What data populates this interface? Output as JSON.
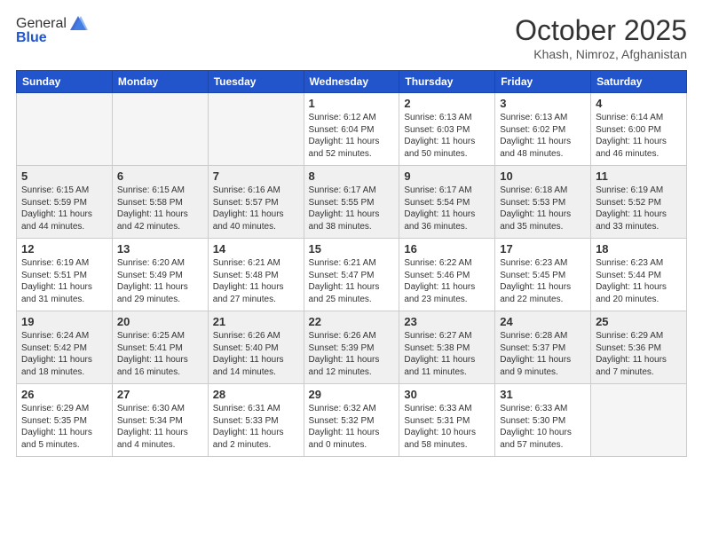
{
  "header": {
    "logo_general": "General",
    "logo_blue": "Blue",
    "month_title": "October 2025",
    "subtitle": "Khash, Nimroz, Afghanistan"
  },
  "weekdays": [
    "Sunday",
    "Monday",
    "Tuesday",
    "Wednesday",
    "Thursday",
    "Friday",
    "Saturday"
  ],
  "weeks": [
    [
      {
        "day": "",
        "empty": true
      },
      {
        "day": "",
        "empty": true
      },
      {
        "day": "",
        "empty": true
      },
      {
        "day": "1",
        "sunrise": "6:12 AM",
        "sunset": "6:04 PM",
        "daylight": "11 hours and 52 minutes."
      },
      {
        "day": "2",
        "sunrise": "6:13 AM",
        "sunset": "6:03 PM",
        "daylight": "11 hours and 50 minutes."
      },
      {
        "day": "3",
        "sunrise": "6:13 AM",
        "sunset": "6:02 PM",
        "daylight": "11 hours and 48 minutes."
      },
      {
        "day": "4",
        "sunrise": "6:14 AM",
        "sunset": "6:00 PM",
        "daylight": "11 hours and 46 minutes."
      }
    ],
    [
      {
        "day": "5",
        "sunrise": "6:15 AM",
        "sunset": "5:59 PM",
        "daylight": "11 hours and 44 minutes."
      },
      {
        "day": "6",
        "sunrise": "6:15 AM",
        "sunset": "5:58 PM",
        "daylight": "11 hours and 42 minutes."
      },
      {
        "day": "7",
        "sunrise": "6:16 AM",
        "sunset": "5:57 PM",
        "daylight": "11 hours and 40 minutes."
      },
      {
        "day": "8",
        "sunrise": "6:17 AM",
        "sunset": "5:55 PM",
        "daylight": "11 hours and 38 minutes."
      },
      {
        "day": "9",
        "sunrise": "6:17 AM",
        "sunset": "5:54 PM",
        "daylight": "11 hours and 36 minutes."
      },
      {
        "day": "10",
        "sunrise": "6:18 AM",
        "sunset": "5:53 PM",
        "daylight": "11 hours and 35 minutes."
      },
      {
        "day": "11",
        "sunrise": "6:19 AM",
        "sunset": "5:52 PM",
        "daylight": "11 hours and 33 minutes."
      }
    ],
    [
      {
        "day": "12",
        "sunrise": "6:19 AM",
        "sunset": "5:51 PM",
        "daylight": "11 hours and 31 minutes."
      },
      {
        "day": "13",
        "sunrise": "6:20 AM",
        "sunset": "5:49 PM",
        "daylight": "11 hours and 29 minutes."
      },
      {
        "day": "14",
        "sunrise": "6:21 AM",
        "sunset": "5:48 PM",
        "daylight": "11 hours and 27 minutes."
      },
      {
        "day": "15",
        "sunrise": "6:21 AM",
        "sunset": "5:47 PM",
        "daylight": "11 hours and 25 minutes."
      },
      {
        "day": "16",
        "sunrise": "6:22 AM",
        "sunset": "5:46 PM",
        "daylight": "11 hours and 23 minutes."
      },
      {
        "day": "17",
        "sunrise": "6:23 AM",
        "sunset": "5:45 PM",
        "daylight": "11 hours and 22 minutes."
      },
      {
        "day": "18",
        "sunrise": "6:23 AM",
        "sunset": "5:44 PM",
        "daylight": "11 hours and 20 minutes."
      }
    ],
    [
      {
        "day": "19",
        "sunrise": "6:24 AM",
        "sunset": "5:42 PM",
        "daylight": "11 hours and 18 minutes."
      },
      {
        "day": "20",
        "sunrise": "6:25 AM",
        "sunset": "5:41 PM",
        "daylight": "11 hours and 16 minutes."
      },
      {
        "day": "21",
        "sunrise": "6:26 AM",
        "sunset": "5:40 PM",
        "daylight": "11 hours and 14 minutes."
      },
      {
        "day": "22",
        "sunrise": "6:26 AM",
        "sunset": "5:39 PM",
        "daylight": "11 hours and 12 minutes."
      },
      {
        "day": "23",
        "sunrise": "6:27 AM",
        "sunset": "5:38 PM",
        "daylight": "11 hours and 11 minutes."
      },
      {
        "day": "24",
        "sunrise": "6:28 AM",
        "sunset": "5:37 PM",
        "daylight": "11 hours and 9 minutes."
      },
      {
        "day": "25",
        "sunrise": "6:29 AM",
        "sunset": "5:36 PM",
        "daylight": "11 hours and 7 minutes."
      }
    ],
    [
      {
        "day": "26",
        "sunrise": "6:29 AM",
        "sunset": "5:35 PM",
        "daylight": "11 hours and 5 minutes."
      },
      {
        "day": "27",
        "sunrise": "6:30 AM",
        "sunset": "5:34 PM",
        "daylight": "11 hours and 4 minutes."
      },
      {
        "day": "28",
        "sunrise": "6:31 AM",
        "sunset": "5:33 PM",
        "daylight": "11 hours and 2 minutes."
      },
      {
        "day": "29",
        "sunrise": "6:32 AM",
        "sunset": "5:32 PM",
        "daylight": "11 hours and 0 minutes."
      },
      {
        "day": "30",
        "sunrise": "6:33 AM",
        "sunset": "5:31 PM",
        "daylight": "10 hours and 58 minutes."
      },
      {
        "day": "31",
        "sunrise": "6:33 AM",
        "sunset": "5:30 PM",
        "daylight": "10 hours and 57 minutes."
      },
      {
        "day": "",
        "empty": true
      }
    ]
  ]
}
